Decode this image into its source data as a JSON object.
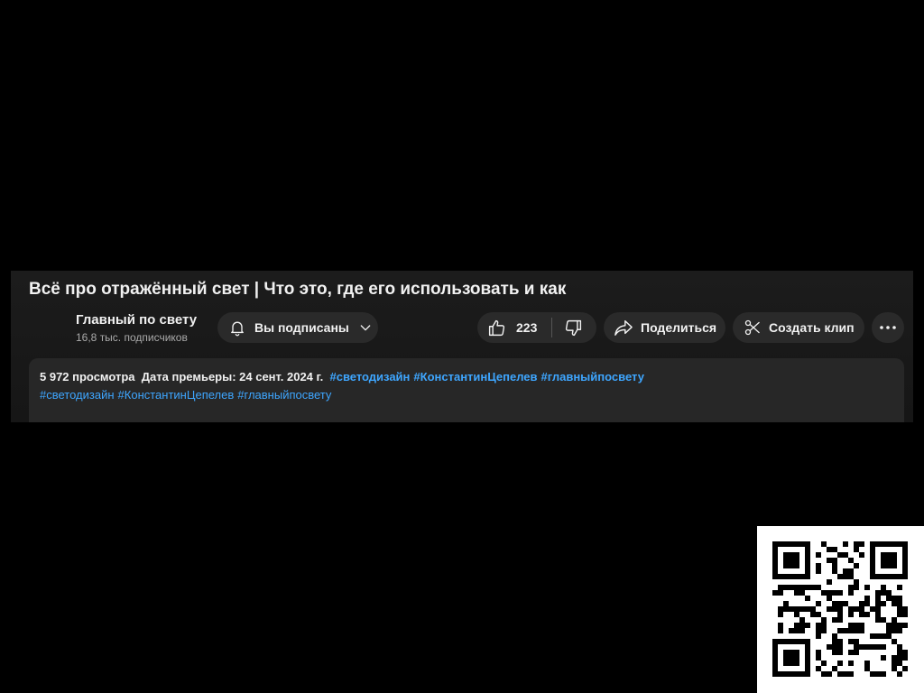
{
  "video": {
    "title": "Всё про отражённый свет | Что это, где его использовать и как"
  },
  "channel": {
    "name": "Главный по свету",
    "subscribers": "16,8 тыс. подписчиков"
  },
  "actions": {
    "subscribe_label": "Вы подписаны",
    "like_count": "223",
    "share_label": "Поделиться",
    "clip_label": "Создать клип"
  },
  "description": {
    "views": "5 972 просмотра",
    "premiere": "Дата премьеры: 24 сент. 2024 г.",
    "tags_line1": [
      "#светодизайн",
      "#КонстантинЦепелев",
      "#главныйпосвету"
    ],
    "tags_line2": [
      "#светодизайн",
      "#КонстантинЦепелев",
      "#главныйпосвету"
    ]
  },
  "colors": {
    "background": "#000000",
    "panel": "#1a1a1a",
    "pill": "#2a2a2a",
    "link": "#3ea6ff",
    "text": "#f1f1f1",
    "muted": "#aaaaaa"
  },
  "icons": {
    "bell": "bell-icon",
    "chevron": "chevron-down-icon",
    "like": "thumbs-up-icon",
    "dislike": "thumbs-down-icon",
    "share": "share-arrow-icon",
    "clip": "scissors-icon",
    "more": "more-horizontal-icon"
  }
}
